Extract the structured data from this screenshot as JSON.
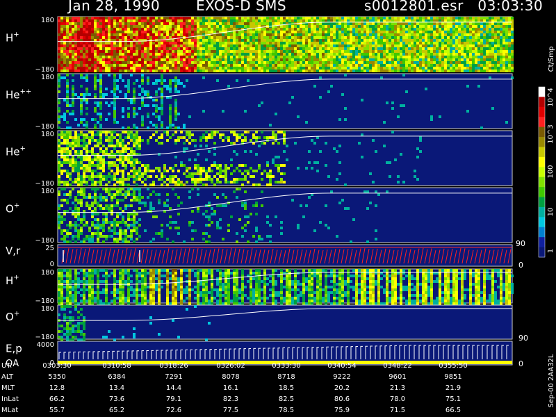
{
  "header": {
    "date": "Jan 28, 1990",
    "instrument": "EXOS-D SMS",
    "file": "s0012801.esr",
    "time": "03:03:30"
  },
  "colorbar": {
    "unit_label": "Ct/Smp",
    "tick_labels": [
      "10^4",
      "10^3",
      "100",
      "10",
      "1"
    ],
    "colors": [
      "#ffffff",
      "#b40000",
      "#e00000",
      "#ff2020",
      "#7a5a00",
      "#9a8a00",
      "#c8c800",
      "#ffff00",
      "#c8ff00",
      "#80e000",
      "#40c800",
      "#00a040",
      "#00b0a0",
      "#00c8e0",
      "#0080d0",
      "#1020a0",
      "#0a1878"
    ]
  },
  "panels": [
    {
      "id": "h_plus",
      "label": "H",
      "sup": "+",
      "tick_top": "180",
      "tick_bottom": "−180"
    },
    {
      "id": "he_pp",
      "label": "He",
      "sup": "++",
      "tick_top": "180",
      "tick_bottom": "−180"
    },
    {
      "id": "he_plus",
      "label": "He",
      "sup": "+",
      "tick_top": "180",
      "tick_bottom": "−180"
    },
    {
      "id": "o_plus",
      "label": "O",
      "sup": "+",
      "tick_top": "180",
      "tick_bottom": "−180"
    },
    {
      "id": "vr",
      "label": "V,r",
      "sup": "",
      "tick_top": "25",
      "tick_bottom": "0",
      "right_top": "90",
      "right_bottom": "0"
    },
    {
      "id": "h_plus2",
      "label": "H",
      "sup": "+",
      "tick_top": "180",
      "tick_bottom": "−180"
    },
    {
      "id": "o_plus2",
      "label": "O",
      "sup": "+",
      "tick_top": "180",
      "tick_bottom": "−180",
      "right_bottom": "90"
    },
    {
      "id": "ep",
      "label": "E,p",
      "label2": "QA",
      "sup": "",
      "tick_top": "4000",
      "tick_bottom": "0",
      "right_bottom": "0"
    }
  ],
  "side_note": "Sep-00  2AA32L",
  "ephemeris": {
    "labels": [
      "UT",
      "ALT",
      "MLT",
      "InLat",
      "MLat"
    ],
    "columns": [
      [
        "0303:30",
        "5350",
        "12.8",
        "66.2",
        "55.7"
      ],
      [
        "0310:58",
        "6384",
        "13.4",
        "73.6",
        "65.2"
      ],
      [
        "0318:26",
        "7291",
        "14.4",
        "79.1",
        "72.6"
      ],
      [
        "0326:02",
        "8078",
        "16.1",
        "82.3",
        "77.5"
      ],
      [
        "0333:30",
        "8718",
        "18.5",
        "82.5",
        "78.5"
      ],
      [
        "0340:54",
        "9222",
        "20.2",
        "80.6",
        "75.9"
      ],
      [
        "0348:22",
        "9601",
        "21.3",
        "78.0",
        "71.5"
      ],
      [
        "0355:50",
        "9851",
        "21.9",
        "75.1",
        "66.5"
      ]
    ]
  }
}
